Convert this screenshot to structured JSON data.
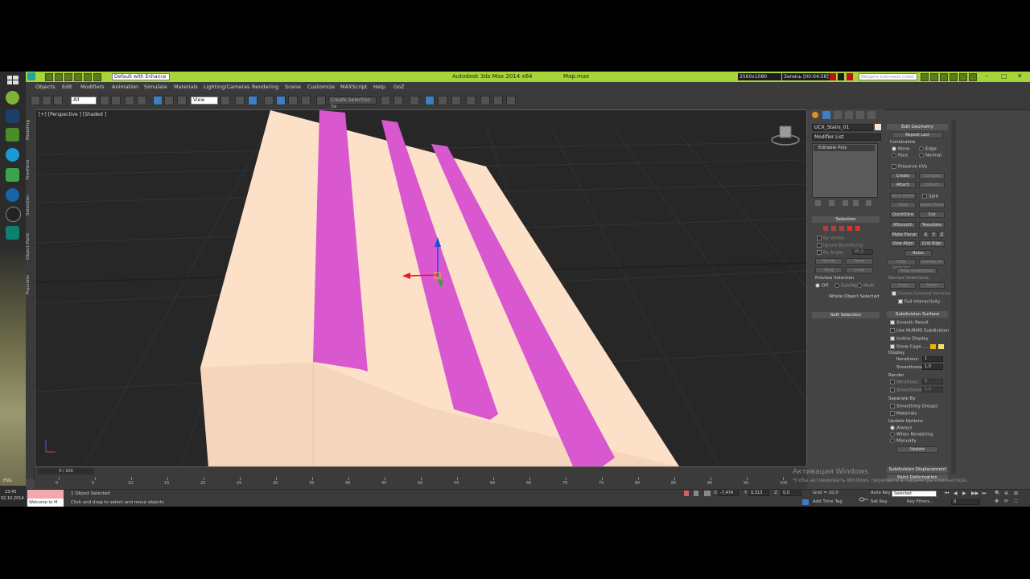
{
  "titlebar": {
    "workspace": "Default with Enhance",
    "app_title": "Autodesk 3ds Max  2014 x64",
    "file_name": "Map.max",
    "resolution": "2560x1080",
    "recording": "Запись [00:04:58]",
    "search_placeholder": "Введите ключевое слово или фразу"
  },
  "menu": [
    "Objects",
    "Edit",
    "Modifiers",
    "Animation",
    "Simulate",
    "Materials",
    "Lighting/Cameras",
    "Rendering",
    "Scene",
    "Customize",
    "MAXScript",
    "Help",
    "GoZ"
  ],
  "toolbar": {
    "filter": "All",
    "ref_coord": "View",
    "named_selection": "Create Selection Se"
  },
  "ribbon": [
    "Modeling",
    "Freeform",
    "Selection",
    "Object Paint",
    "Populate"
  ],
  "viewport": {
    "label": "[+] [Perspective ] [Shaded ]"
  },
  "cmdpanel": {
    "object_name": "UCX_Stairs_01",
    "modifier_list": "Modifier List",
    "stack_item": "Editable Poly",
    "selection_hdr": "Selection",
    "by_vertex": "By Vertex",
    "ignore_backfacing": "Ignore Backfacing",
    "by_angle": "By Angle:",
    "by_angle_val": "45,0",
    "shrink": "Shrink",
    "grow": "Grow",
    "ring": "Ring",
    "loop": "Loop",
    "preview_selection": "Preview Selection",
    "off": "Off",
    "subobj": "SubObj",
    "multi": "Multi",
    "whole_object_selected": "Whole Object Selected",
    "soft_selection": "Soft Selection"
  },
  "edit_geometry": {
    "hdr": "Edit Geometry",
    "repeat_last": "Repeat Last",
    "constraints": "Constraints",
    "none": "None",
    "edge": "Edge",
    "face": "Face",
    "normal": "Normal",
    "preserve_uvs": "Preserve UVs",
    "create": "Create",
    "collapse": "Collapse",
    "attach": "Attach",
    "detach": "Detach",
    "slice_plane": "Slice Plane",
    "split": "Split",
    "slice": "Slice",
    "reset_plane": "Reset Plane",
    "quickslice": "QuickSlice",
    "cut": "Cut",
    "msmooth": "MSmooth",
    "tessellate": "Tessellate",
    "make_planar": "Make Planar",
    "x": "X",
    "y": "Y",
    "z": "Z",
    "view_align": "View Align",
    "grid_align": "Grid Align",
    "relax": "Relax",
    "hide_selected": "Hide Selected",
    "unhide_all": "Unhide All",
    "hide_unselected": "Hide Unselected",
    "named_selections": "Named Selections:",
    "copy": "Copy",
    "paste": "Paste",
    "delete_isolated": "Delete Isolated Vertices",
    "full_interactivity": "Full Interactivity"
  },
  "subdivision": {
    "hdr": "Subdivision Surface",
    "smooth_result": "Smooth Result",
    "use_nurms": "Use NURMS Subdivision",
    "isoline_display": "Isoline Display",
    "show_cage": "Show Cage......",
    "display": "Display",
    "iterations": "Iterations:",
    "iter_val": "1",
    "smoothness": "Smoothness:",
    "smooth_val": "1,0",
    "render": "Render",
    "r_iterations": "Iterations:",
    "r_iter_val": "0",
    "r_smoothness": "Smoothness:",
    "r_smooth_val": "1,0",
    "separate_by": "Separate By",
    "smoothing_groups": "Smoothing Groups",
    "materials": "Materials",
    "update_options": "Update Options",
    "always": "Always",
    "when_rendering": "When Rendering",
    "manually": "Manually",
    "update": "Update",
    "subdiv_displacement": "Subdivision Displacement",
    "paint_deformation": "Paint Deformation"
  },
  "timeline": {
    "frame": "0 / 100",
    "ticks": [
      "0",
      "5",
      "10",
      "15",
      "20",
      "25",
      "30",
      "35",
      "40",
      "45",
      "50",
      "55",
      "60",
      "65",
      "70",
      "75",
      "80",
      "85",
      "90",
      "95",
      "100"
    ]
  },
  "status": {
    "selected": "1 Object Selected",
    "prompt": "Click and drag to select and move objects",
    "welcome": "Welcome to M",
    "x_label": "X:",
    "x_val": "-7,474",
    "y_label": "Y:",
    "y_val": "0,313",
    "z_label": "Z:",
    "z_val": "0,0",
    "grid": "Grid = 10,0",
    "auto_key": "Auto Key",
    "selected_combo": "Selected",
    "set_key": "Set Key",
    "key_filters": "Key Filters...",
    "add_time_tag": "Add Time Tag",
    "frame_val": "0"
  },
  "watermark": {
    "line1": "Активация Windows",
    "line2": "Чтобы активировать Windows, перейдите в параметры компьютера."
  },
  "taskbar": {
    "lang": "ENG",
    "time": "23:45",
    "date": "02.10.2014"
  },
  "colors": {
    "title_green": "#a6d43b",
    "stair_base": "#fde0c8",
    "stripe_magenta": "#d957cf",
    "selection_blue": "#3d7fc0"
  }
}
